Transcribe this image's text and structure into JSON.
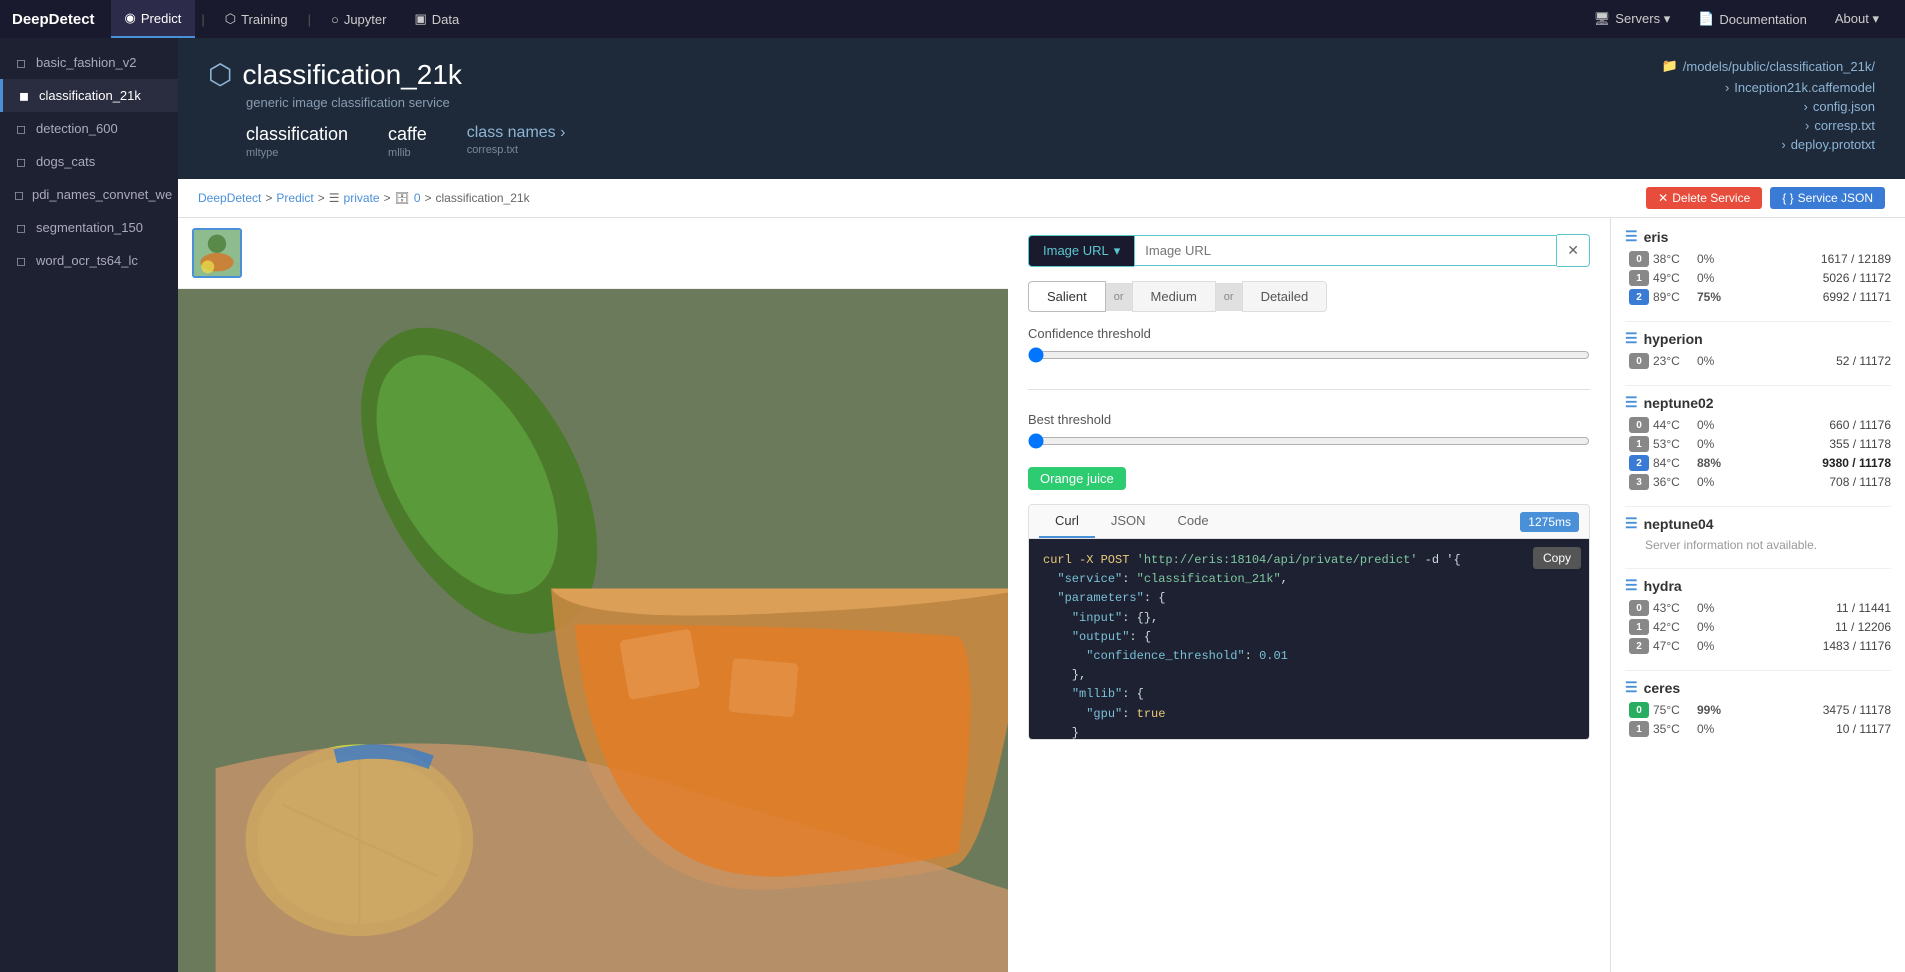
{
  "app": {
    "brand": "DeepDetect",
    "nav_items": [
      {
        "id": "predict",
        "label": "Predict",
        "active": true,
        "icon": "◉"
      },
      {
        "id": "training",
        "label": "Training",
        "active": false,
        "icon": "⬡"
      },
      {
        "id": "jupyter",
        "label": "Jupyter",
        "active": false,
        "icon": "○"
      },
      {
        "id": "data",
        "label": "Data",
        "active": false,
        "icon": "▣"
      }
    ],
    "nav_right": [
      {
        "id": "servers",
        "label": "Servers ▾",
        "icon": "🖥"
      },
      {
        "id": "documentation",
        "label": "Documentation",
        "icon": "📄"
      },
      {
        "id": "about",
        "label": "About ▾"
      }
    ]
  },
  "sidebar": {
    "items": [
      {
        "id": "basic_fashion_v2",
        "label": "basic_fashion_v2",
        "active": false
      },
      {
        "id": "classification_21k",
        "label": "classification_21k",
        "active": true
      },
      {
        "id": "detection_600",
        "label": "detection_600",
        "active": false
      },
      {
        "id": "dogs_cats",
        "label": "dogs_cats",
        "active": false
      },
      {
        "id": "pdi_names_convnet_we",
        "label": "pdi_names_convnet_we",
        "active": false
      },
      {
        "id": "segmentation_150",
        "label": "segmentation_150",
        "active": false
      },
      {
        "id": "word_ocr_ts64_lc",
        "label": "word_ocr_ts64_lc",
        "active": false
      }
    ]
  },
  "service": {
    "title": "classification_21k",
    "subtitle": "generic image classification service",
    "mltype": {
      "label": "mltype",
      "value": "classification"
    },
    "mllib": {
      "label": "mllib",
      "value": "caffe"
    },
    "classnames": {
      "label": "class names ›",
      "sublabel": "corresp.txt"
    },
    "path": "/models/public/classification_21k/",
    "files": [
      "Inception21k.caffemodel",
      "config.json",
      "corresp.txt",
      "deploy.prototxt"
    ]
  },
  "breadcrumb": {
    "parts": [
      "DeepDetect",
      "Predict",
      "private",
      "0",
      "classification_21k"
    ],
    "separators": [
      ">",
      ">",
      ">",
      ">"
    ],
    "delete_label": "Delete Service",
    "json_label": "Service JSON"
  },
  "predict": {
    "url_placeholder": "Image URL",
    "url_button": "Image URL",
    "modes": [
      "Salient",
      "Medium",
      "Detailed"
    ],
    "confidence_label": "Confidence threshold",
    "best_threshold_label": "Best threshold",
    "result_tag": "Orange juice",
    "tabs": [
      "Curl",
      "JSON",
      "Code"
    ],
    "active_tab": "Curl",
    "timing": "1275ms",
    "copy_label": "Copy",
    "code": "curl -X POST 'http://eris:18104/api/private/predict' -d '{\n  \"service\": \"classification_21k\",\n  \"parameters\": {\n    \"input\": {},\n    \"output\": {\n      \"confidence_threshold\": 0.01\n    },\n    \"mllib\": {\n      \"gpu\": true\n    }\n  },\n  \"data\": ["
  },
  "servers": {
    "groups": [
      {
        "name": "eris",
        "available": true,
        "gpus": [
          {
            "id": "0",
            "badge_color": "gpu-gray",
            "temp": "38°C",
            "util": "0%",
            "mem": "1617 / 12189"
          },
          {
            "id": "1",
            "badge_color": "gpu-gray",
            "temp": "49°C",
            "util": "0%",
            "mem": "5026 / 11172"
          },
          {
            "id": "2",
            "badge_color": "gpu-blue",
            "temp": "89°C",
            "util": "75%",
            "mem": "6992 / 11171",
            "highlight": true
          }
        ]
      },
      {
        "name": "hyperion",
        "available": true,
        "gpus": [
          {
            "id": "0",
            "badge_color": "gpu-gray",
            "temp": "23°C",
            "util": "0%",
            "mem": "52 / 11172"
          }
        ]
      },
      {
        "name": "neptune02",
        "available": true,
        "gpus": [
          {
            "id": "0",
            "badge_color": "gpu-gray",
            "temp": "44°C",
            "util": "0%",
            "mem": "660 / 11176"
          },
          {
            "id": "1",
            "badge_color": "gpu-gray",
            "temp": "53°C",
            "util": "0%",
            "mem": "355 / 11178"
          },
          {
            "id": "2",
            "badge_color": "gpu-blue",
            "temp": "84°C",
            "util": "88%",
            "mem": "9380 / 11178",
            "highlight": true,
            "mem_bold": true
          },
          {
            "id": "3",
            "badge_color": "gpu-gray",
            "temp": "36°C",
            "util": "0%",
            "mem": "708 / 11178"
          }
        ]
      },
      {
        "name": "neptune04",
        "available": false,
        "unavailable_text": "Server information not available."
      },
      {
        "name": "hydra",
        "available": true,
        "gpus": [
          {
            "id": "0",
            "badge_color": "gpu-gray",
            "temp": "43°C",
            "util": "0%",
            "mem": "11 / 11441"
          },
          {
            "id": "1",
            "badge_color": "gpu-gray",
            "temp": "42°C",
            "util": "0%",
            "mem": "11 / 12206"
          },
          {
            "id": "2",
            "badge_color": "gpu-gray",
            "temp": "47°C",
            "util": "0%",
            "mem": "1483 / 11176"
          }
        ]
      },
      {
        "name": "ceres",
        "available": true,
        "gpus": [
          {
            "id": "0",
            "badge_color": "gpu-green",
            "temp": "75°C",
            "util": "99%",
            "mem": "3475 / 11178",
            "highlight": true
          },
          {
            "id": "1",
            "badge_color": "gpu-gray",
            "temp": "35°C",
            "util": "0%",
            "mem": "10 / 11177"
          }
        ]
      }
    ]
  }
}
